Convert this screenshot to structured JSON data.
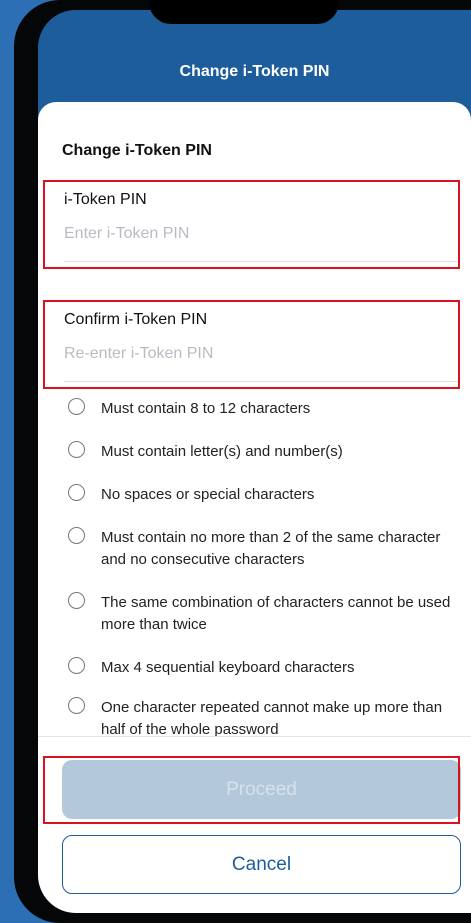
{
  "header": {
    "title": "Change i-Token PIN"
  },
  "page": {
    "title": "Change i-Token PIN"
  },
  "pin_field": {
    "label": "i-Token PIN",
    "placeholder": "Enter i-Token PIN",
    "value": ""
  },
  "confirm_field": {
    "label": "Confirm i-Token PIN",
    "placeholder": "Re-enter i-Token PIN",
    "value": ""
  },
  "rules": [
    "Must contain 8 to 12 characters",
    "Must contain letter(s) and number(s)",
    "No spaces or special characters",
    "Must contain no more than 2 of the same character and no consecutive characters",
    "The same combination of characters cannot be used more than twice",
    "Max 4 sequential keyboard characters",
    "One character repeated cannot make up more than half of the whole password"
  ],
  "buttons": {
    "proceed": "Proceed",
    "cancel": "Cancel"
  },
  "colors": {
    "header_bg": "#1d5d9b",
    "highlight": "#d9121f",
    "proceed_disabled": "#b3c8da",
    "cancel_text": "#1d5d9b"
  }
}
